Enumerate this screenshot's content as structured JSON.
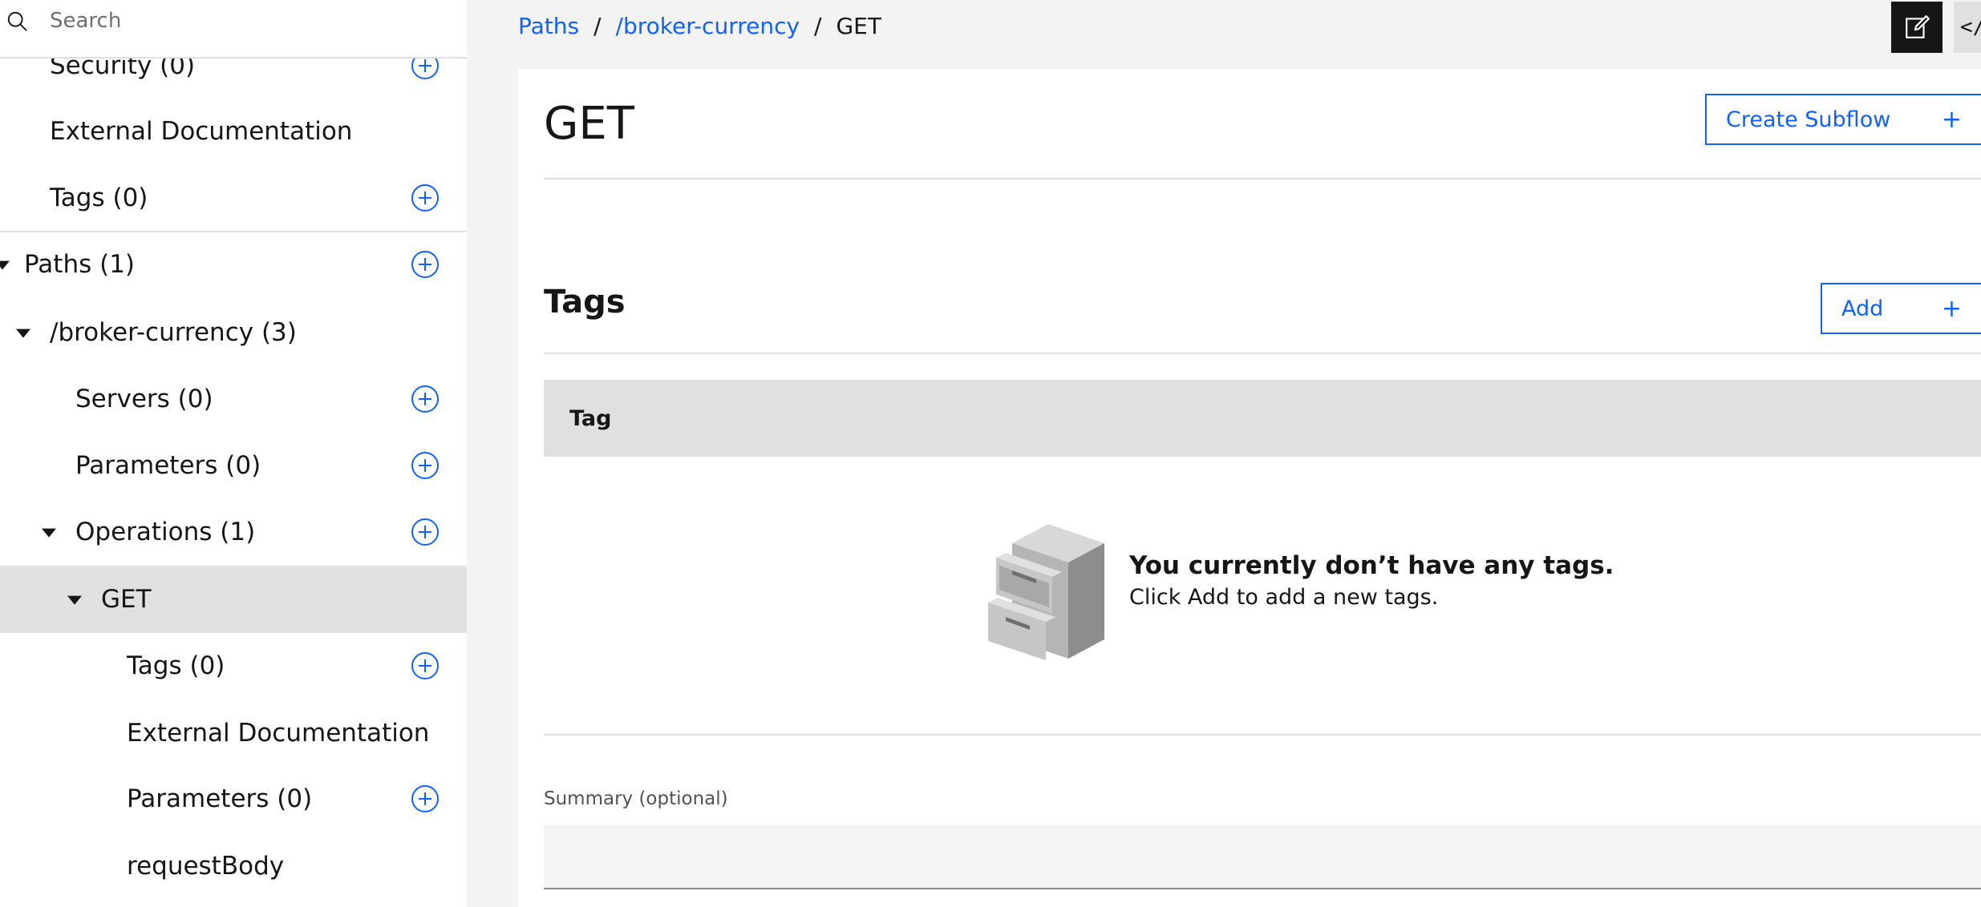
{
  "search": {
    "placeholder": "Search",
    "value": ""
  },
  "sidebar": {
    "items": [
      {
        "label": "Security (0)"
      },
      {
        "label": "External Documentation"
      },
      {
        "label": "Tags (0)"
      },
      {
        "label": "Paths (1)"
      },
      {
        "label": "/broker-currency (3)"
      },
      {
        "label": "Servers (0)"
      },
      {
        "label": "Parameters (0)"
      },
      {
        "label": "Operations (1)"
      },
      {
        "label": "GET"
      },
      {
        "label": "Tags (0)"
      },
      {
        "label": "External Documentation"
      },
      {
        "label": "Parameters (0)"
      },
      {
        "label": "requestBody"
      }
    ]
  },
  "breadcrumb": {
    "items": [
      "Paths",
      "/broker-currency",
      "GET"
    ],
    "separator": "/"
  },
  "toolbar": {
    "code_label": "</"
  },
  "main": {
    "title": "GET",
    "create_subflow_label": "Create Subflow",
    "plus": "+",
    "tags": {
      "title": "Tags",
      "add_label": "Add",
      "column_header": "Tag",
      "empty_title": "You currently don’t have any tags.",
      "empty_description": "Click Add to add a new tags."
    },
    "summary": {
      "label": "Summary (optional)",
      "value": ""
    }
  },
  "colors": {
    "accent": "#0f62fe",
    "selected_bg": "#e0e0e0",
    "page_bg": "#f3f3f3"
  }
}
